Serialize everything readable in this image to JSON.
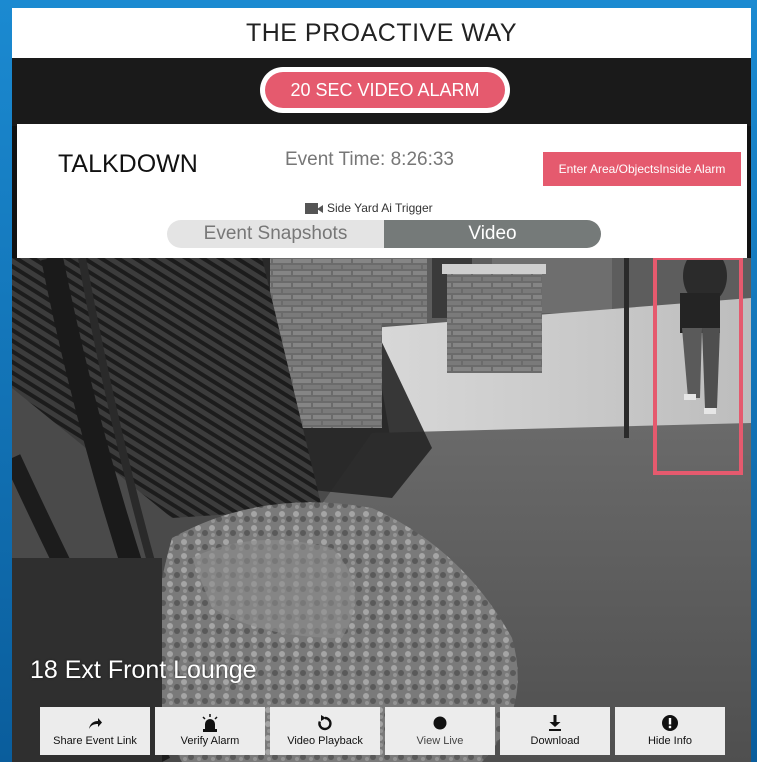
{
  "header": {
    "title": "THE PROACTIVE WAY"
  },
  "alarm": {
    "label": "20 SEC VIDEO ALARM",
    "color": "#e55a6e"
  },
  "info": {
    "mode": "TALKDOWN",
    "event_time": "Event Time: 8:26:33",
    "enter_area_label": "Enter Area/ObjectsInside Alarm",
    "trigger_text": "Side Yard Ai Trigger",
    "trigger_icon": "video-camera-icon"
  },
  "view_toggle": {
    "options": [
      {
        "label": "Event Snapshots",
        "active": false
      },
      {
        "label": "Video",
        "active": true
      }
    ]
  },
  "camera": {
    "name": "18 Ext Front Lounge",
    "detection_box_color": "#e55a6e"
  },
  "toolbar": {
    "buttons": [
      {
        "label": "Share Event Link",
        "icon": "share-arrow-icon"
      },
      {
        "label": "Verify Alarm",
        "icon": "siren-icon"
      },
      {
        "label": "Video Playback",
        "icon": "replay-icon"
      },
      {
        "label": "View Live",
        "icon": "record-dot-icon"
      },
      {
        "label": "Download",
        "icon": "download-icon"
      },
      {
        "label": "Hide Info",
        "icon": "info-icon"
      }
    ]
  }
}
